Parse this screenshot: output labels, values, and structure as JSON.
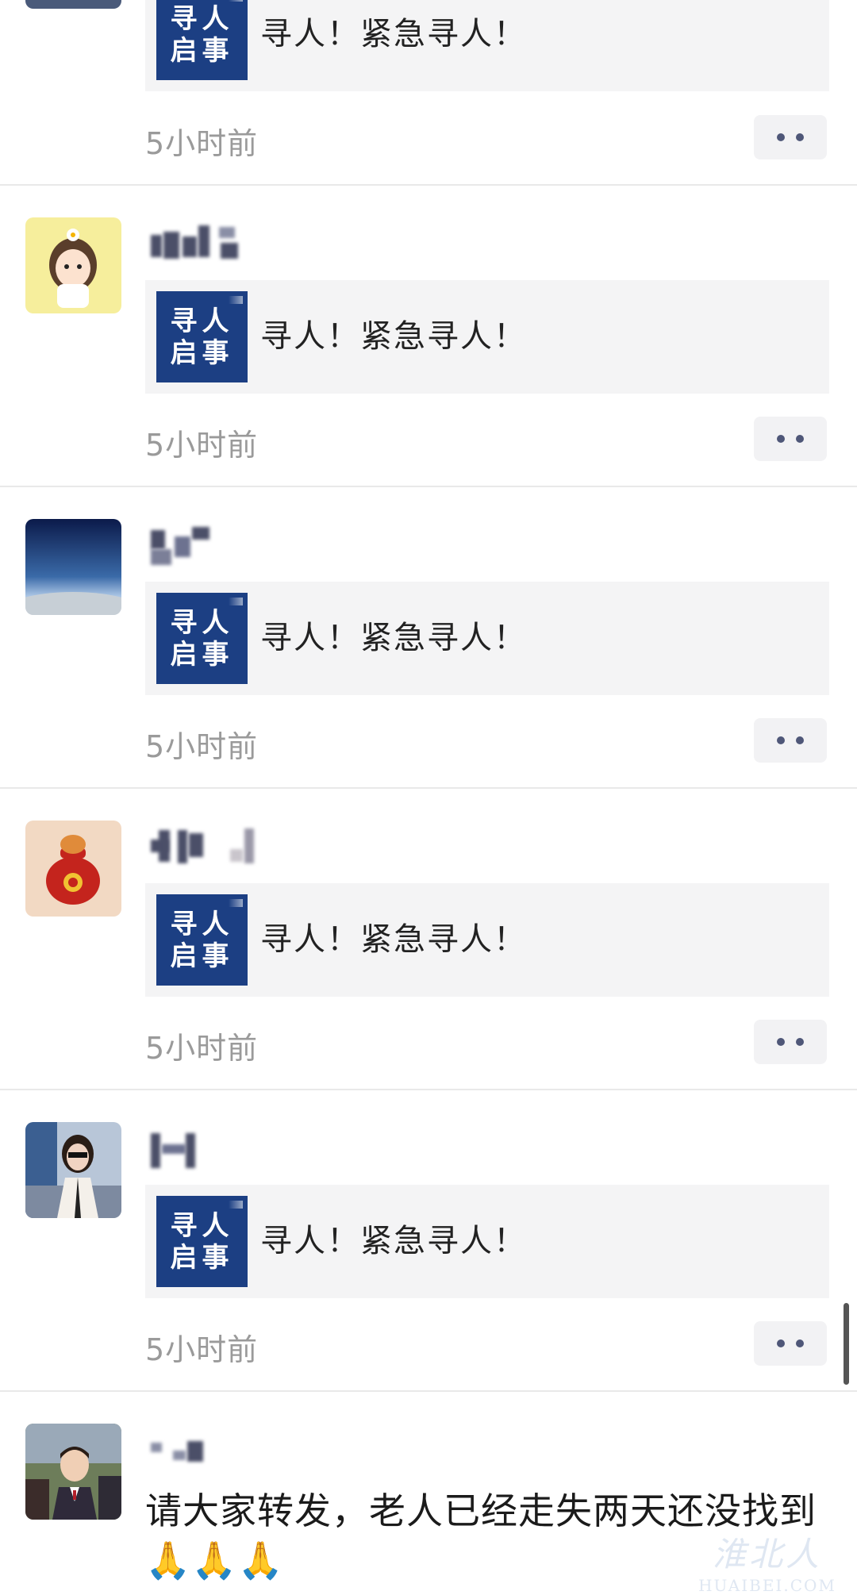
{
  "posts": [
    {
      "avatar": "none-visible",
      "name": "",
      "card": {
        "thumb_line1": "寻人",
        "thumb_line2": "启事",
        "title": "寻人！紧急寻人！"
      },
      "time": "5小时前"
    },
    {
      "avatar": "cartoon-girl-avatar",
      "name": "",
      "card": {
        "thumb_line1": "寻人",
        "thumb_line2": "启事",
        "title": "寻人！紧急寻人！"
      },
      "time": "5小时前"
    },
    {
      "avatar": "earth-horizon-avatar",
      "name": "",
      "card": {
        "thumb_line1": "寻人",
        "thumb_line2": "启事",
        "title": "寻人！紧急寻人！"
      },
      "time": "5小时前"
    },
    {
      "avatar": "lucky-bag-avatar",
      "name": "",
      "card": {
        "thumb_line1": "寻人",
        "thumb_line2": "启事",
        "title": "寻人！紧急寻人！"
      },
      "time": "5小时前"
    },
    {
      "avatar": "woman-photo-avatar",
      "name": "",
      "card": {
        "thumb_line1": "寻人",
        "thumb_line2": "启事",
        "title": "寻人！紧急寻人！"
      },
      "time": "5小时前"
    },
    {
      "avatar": "child-photo-avatar",
      "name": "",
      "text": "请大家转发，老人已经走失两天还没找到🙏🙏🙏"
    }
  ],
  "watermark": {
    "top": "淮北人",
    "bottom": "HUAIBEI.COM"
  },
  "colors": {
    "thumb_bg": "#1c3f83",
    "card_bg": "#f4f4f5",
    "timestamp": "#9a9a9a",
    "dots": "#4f5778"
  }
}
